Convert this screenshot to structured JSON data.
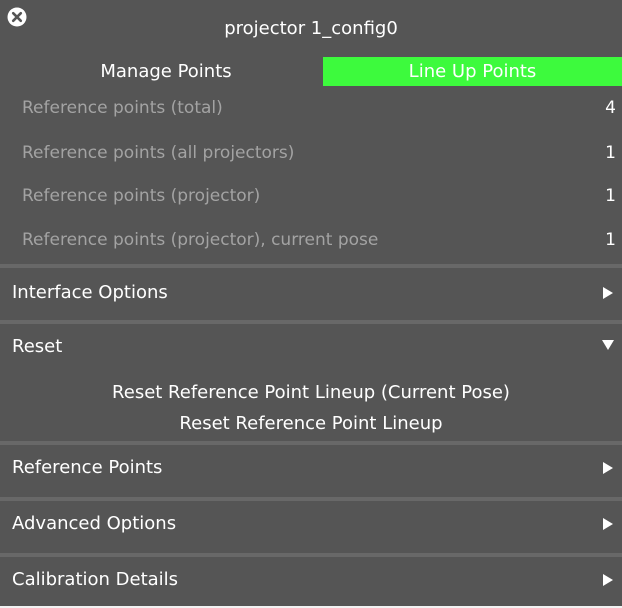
{
  "window": {
    "title": "projector 1_config0",
    "close_icon": "close-circle-icon"
  },
  "mode_tabs": [
    {
      "label": "Manage Points",
      "active": false
    },
    {
      "label": "Line Up Points",
      "active": true
    }
  ],
  "stats": [
    {
      "label": "Reference points (total)",
      "value": "4"
    },
    {
      "label": "Reference points (all projectors)",
      "value": "1"
    },
    {
      "label": "Reference points (projector)",
      "value": "1"
    },
    {
      "label": "Reference points (projector), current pose",
      "value": "1"
    }
  ],
  "sections": {
    "interface_options": {
      "label": "Interface Options",
      "expanded": false,
      "icon": "arrow-right-icon"
    },
    "reset": {
      "label": "Reset",
      "expanded": true,
      "icon": "arrow-down-icon",
      "actions": [
        "Reset Reference Point Lineup (Current Pose)",
        "Reset Reference Point Lineup"
      ]
    },
    "reference_points": {
      "label": "Reference Points",
      "expanded": false,
      "icon": "arrow-right-icon"
    },
    "advanced_options": {
      "label": "Advanced Options",
      "expanded": false,
      "icon": "arrow-right-icon"
    },
    "calibration_details": {
      "label": "Calibration Details",
      "expanded": false,
      "icon": "arrow-right-icon"
    }
  },
  "colors": {
    "panel_bg": "#555555",
    "active_tab": "#3dfa3d",
    "muted_text": "#a3a3a3",
    "separator": "#686868"
  }
}
